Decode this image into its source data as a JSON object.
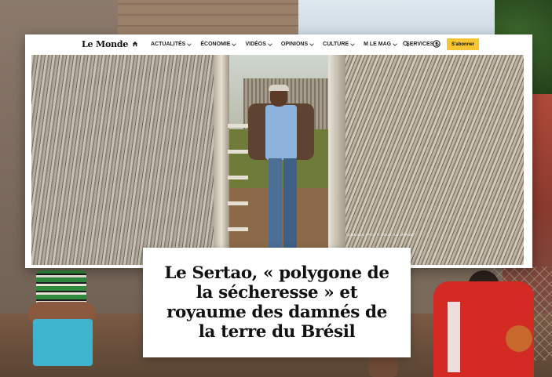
{
  "nav": {
    "logo": "Le Monde",
    "items": [
      {
        "label": "ACTUALITÉS",
        "dropdown": true
      },
      {
        "label": "ÉCONOMIE",
        "dropdown": true
      },
      {
        "label": "VIDÉOS",
        "dropdown": true
      },
      {
        "label": "OPINIONS",
        "dropdown": true
      },
      {
        "label": "CULTURE",
        "dropdown": true
      },
      {
        "label": "M LE MAG",
        "dropdown": true
      },
      {
        "label": "SERVICES",
        "dropdown": true
      }
    ],
    "subscribe_label": "S'abonner",
    "accent_color": "#f7c52f"
  },
  "article": {
    "photo_credit": "TOMMASO PROTTI POUR \"LE MONDE\"",
    "headline": "Le Sertao, « polygone de la sécheresse » et royaume des damnés de la terre du Brésil"
  },
  "icons": [
    "home-icon",
    "search-icon",
    "user-icon",
    "chevron-down-icon"
  ]
}
